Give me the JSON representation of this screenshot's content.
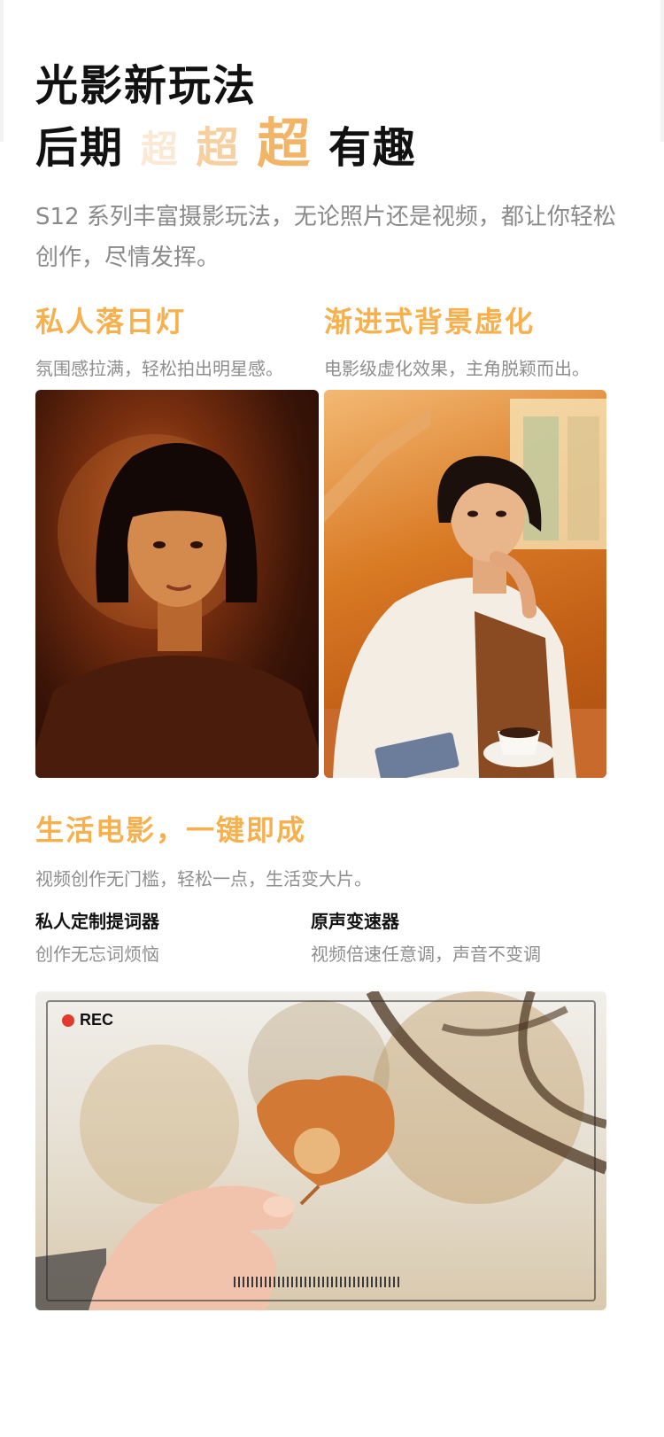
{
  "headline": {
    "line1": "光影新玩法",
    "line2_prefix": "后期",
    "super1": "超",
    "super2": "超",
    "super3": "超",
    "line2_suffix": "有趣"
  },
  "intro": "S12 系列丰富摄影玩法，无论照片还是视频，都让你轻松创作，尽情发挥。",
  "features": [
    {
      "title": "私人落日灯",
      "desc": "氛围感拉满，轻松拍出明星感。"
    },
    {
      "title": "渐进式背景虚化",
      "desc": "电影级虚化效果，主角脱颖而出。"
    }
  ],
  "section3": {
    "title": "生活电影，一键即成",
    "desc": "视频创作无门槛，轻松一点，生活变大片。"
  },
  "sub_features": [
    {
      "title": "私人定制提词器",
      "desc": "创作无忘词烦恼"
    },
    {
      "title": "原声变速器",
      "desc": "视频倍速任意调，声音不变调"
    }
  ],
  "video": {
    "rec_label": "REC"
  },
  "colors": {
    "accent": "#f6b04e",
    "super1": "#fbe9d5",
    "super2": "#f7d0a1",
    "super3": "#f2b467",
    "rec": "#e23a2c"
  }
}
